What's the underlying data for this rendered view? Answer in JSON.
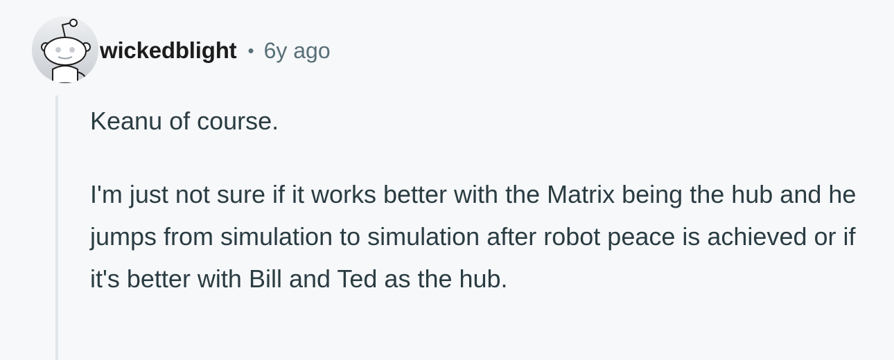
{
  "comment": {
    "author": "wickedblight",
    "separator": "•",
    "timestamp": "6y ago",
    "avatar_icon": "reddit-snoo-avatar-icon",
    "paragraphs": [
      "Keanu of course.",
      "I'm just not sure if it works better with the Matrix being the hub and he jumps from simulation to simulation after robot peace is achieved or if it's better with Bill and Ted as the hub."
    ]
  },
  "colors": {
    "background": "#f7f8fa",
    "username": "#1c1c1c",
    "meta": "#576f76",
    "body_text": "#2a3c42",
    "thread_line": "#e1e6ea",
    "avatar_bg": "#d4d8dd"
  }
}
